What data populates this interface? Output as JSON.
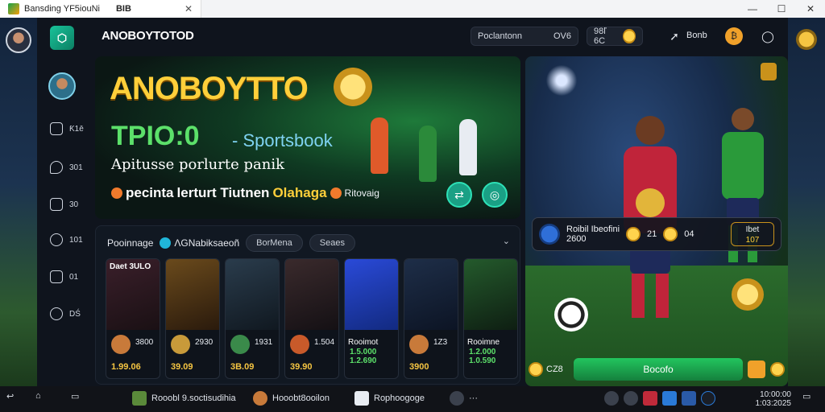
{
  "window": {
    "tab_title": "Bansding YF5iouNi",
    "tab2_label": "BIB",
    "close_tab": "✕",
    "controls": [
      "—",
      "☐",
      "✕"
    ]
  },
  "app": {
    "brand": "ANOBOYTOTOD",
    "logo_letter": "⬡",
    "search_pill": {
      "label": "Poclantonn",
      "value": "OV6"
    },
    "balance_pill": {
      "label": "98ľ 6C"
    },
    "login_label": "Bonb",
    "accent": "#19c39a"
  },
  "sidebar": {
    "items": [
      {
        "icon": "trophy-icon",
        "label": "Ƙ1ē"
      },
      {
        "icon": "chat-icon",
        "label": "301"
      },
      {
        "icon": "phone-icon",
        "label": "30"
      },
      {
        "icon": "globe-icon",
        "label": "101"
      },
      {
        "icon": "home-icon",
        "label": "01"
      },
      {
        "icon": "refresh-icon",
        "label": "DŚ"
      }
    ]
  },
  "hero": {
    "title": "ANOBOYTTO",
    "subtitle_code": "TPIO:0",
    "subtitle_text": "- Sportsbook",
    "tagline": "Apitusse porlurte panik",
    "promo_start": "pecinta",
    "promo_mid": "lerturt Tiutnen",
    "promo_highlight": "Olahaga",
    "promo_small": "Ritovaig"
  },
  "tiles_section": {
    "heading": "Pooinnage",
    "tag": "ΛGNabiksaeoñ",
    "chips": [
      "BorMena",
      "Seaes"
    ],
    "tiles": [
      {
        "title": "Daet 3ULO",
        "v1": "3800",
        "v2": "1.99.06",
        "art": "#3a1f2a",
        "ico": "#c87a3a"
      },
      {
        "title": "",
        "v1": "2930",
        "v2": "39.09",
        "art": "#5a3e1c",
        "ico": "#c89a3a"
      },
      {
        "title": "",
        "v1": "1931",
        "v2": "3B.09",
        "art": "#1f2d3c",
        "ico": "#3a8a4a"
      },
      {
        "title": "",
        "v1": "1.504",
        "v2": "39.90",
        "art": "#2a1e22",
        "ico": "#c85a2a"
      },
      {
        "title": "",
        "label": "Rooimot",
        "v3a": "1.5.000",
        "v3b": "1.2.690",
        "art": "#1d3aa8",
        "ico": "#2a5ad8"
      },
      {
        "title": "",
        "v1": "1Z3",
        "v2": "3900",
        "art": "#152238",
        "ico": "#c87a3a"
      },
      {
        "title": "",
        "label": "Rooimne",
        "v3a": "1.2.000",
        "v3b": "1.0.590",
        "art": "#1d3a22",
        "ico": "#3a8a4a"
      }
    ]
  },
  "feature": {
    "stats_name": "Roibil Ibeofini",
    "stats_val": "2600",
    "stats_odds1": "21",
    "stats_odds2": "04",
    "box_top": "Ibet",
    "box_bottom": "107",
    "bet_label": "CZ8",
    "bet_button": "Bocofo"
  },
  "taskbar": {
    "items": [
      {
        "label": "Rooobl 9.soctisudihia"
      },
      {
        "label": "Hooobt8ooilon"
      },
      {
        "label": "Rophoogoge"
      },
      {
        "label": "···"
      }
    ],
    "clock_time": "10:00:00",
    "clock_date": "1:03:2025"
  }
}
